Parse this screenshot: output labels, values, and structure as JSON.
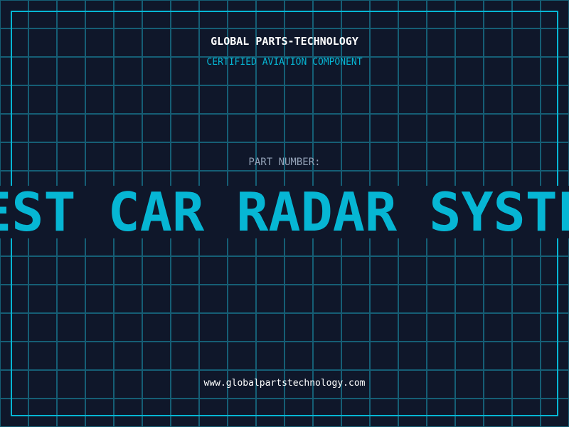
{
  "header": {
    "company": "GLOBAL PARTS-TECHNOLOGY",
    "subtitle": "CERTIFIED AVIATION COMPONENT"
  },
  "part": {
    "label": "PART NUMBER:",
    "value": "BEST CAR RADAR SYSTEM"
  },
  "footer": {
    "url": "www.globalpartstechnology.com"
  },
  "colors": {
    "background": "#0f172a",
    "accent": "#06b6d4",
    "grid": "#155e75"
  }
}
